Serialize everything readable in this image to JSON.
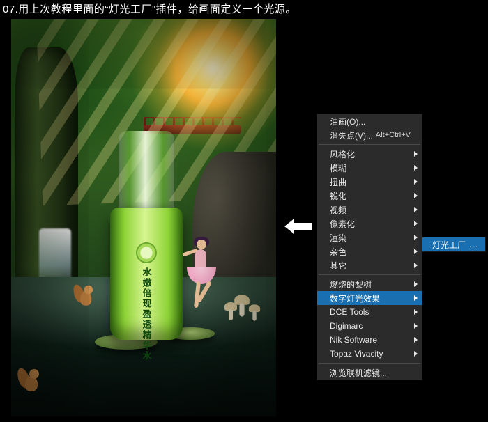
{
  "caption": "07.用上次教程里面的“灯光工厂”插件，给画面定义一个光源。",
  "artwork": {
    "bottle_text": "水嫩倍现盈透精华水"
  },
  "menu": {
    "groups": [
      [
        {
          "label": "油画(O)...",
          "shortcut": "",
          "submenu": false
        },
        {
          "label": "消失点(V)...",
          "shortcut": "Alt+Ctrl+V",
          "submenu": false
        }
      ],
      [
        {
          "label": "风格化",
          "submenu": true
        },
        {
          "label": "模糊",
          "submenu": true
        },
        {
          "label": "扭曲",
          "submenu": true
        },
        {
          "label": "锐化",
          "submenu": true
        },
        {
          "label": "视频",
          "submenu": true
        },
        {
          "label": "像素化",
          "submenu": true
        },
        {
          "label": "渲染",
          "submenu": true
        },
        {
          "label": "杂色",
          "submenu": true
        },
        {
          "label": "其它",
          "submenu": true
        }
      ],
      [
        {
          "label": "燃烧的梨树",
          "submenu": true
        },
        {
          "label": "数字灯光效果",
          "submenu": true,
          "selected": true
        },
        {
          "label": "DCE Tools",
          "submenu": true
        },
        {
          "label": "Digimarc",
          "submenu": true
        },
        {
          "label": "Nik Software",
          "submenu": true
        },
        {
          "label": "Topaz Vivacity",
          "submenu": true
        }
      ],
      [
        {
          "label": "浏览联机滤镜...",
          "submenu": false
        }
      ]
    ]
  },
  "submenu": {
    "items": [
      {
        "label": "灯光工厂",
        "ellipsis": "...",
        "selected": true
      }
    ]
  },
  "colors": {
    "menu_highlight": "#1a6fb0",
    "menu_bg": "#2b2b2b"
  }
}
